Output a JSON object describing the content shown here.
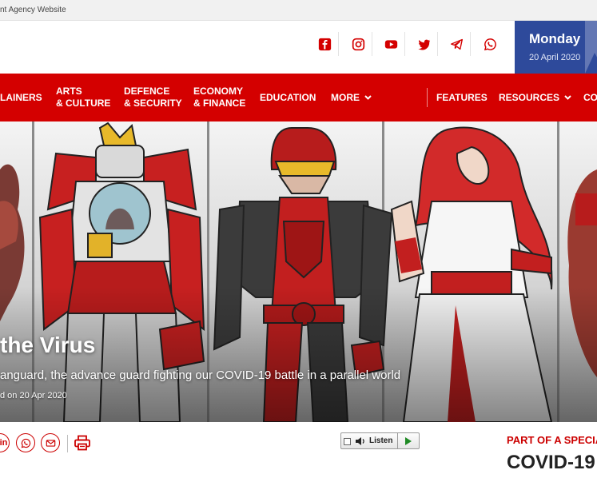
{
  "top_strip": {
    "text": "nt Agency Website"
  },
  "social": {
    "icons": [
      "facebook-icon",
      "instagram-icon",
      "youtube-icon",
      "twitter-icon",
      "telegram-icon",
      "whatsapp-icon"
    ],
    "color": "#d40000"
  },
  "date_box": {
    "day": "Monday",
    "date": "20 April 2020",
    "color": "#2e4a9b"
  },
  "nav": {
    "color": "#d40000",
    "items": [
      {
        "line1": "LAINERS"
      },
      {
        "line1": "ARTS",
        "line2": "& CULTURE"
      },
      {
        "line1": "DEFENCE",
        "line2": "& SECURITY"
      },
      {
        "line1": "ECONOMY",
        "line2": "& FINANCE"
      },
      {
        "line1": "EDUCATION"
      },
      {
        "line1": "MORE",
        "caret": "chevron-down-icon"
      },
      {
        "line1": "FEATURES"
      },
      {
        "line1": "RESOURCES",
        "caret": "chevron-down-icon"
      },
      {
        "line1": "CO"
      }
    ]
  },
  "hero": {
    "title": "the Virus",
    "subtitle": "anguard, the advance guard fighting our COVID-19 battle in a parallel world",
    "meta": "d on 20 Apr 2020"
  },
  "share": {
    "linkedin_text": "in",
    "icons": [
      "linkedin-icon",
      "whatsapp-icon",
      "email-icon",
      "print-icon"
    ]
  },
  "listen": {
    "label": "Listen"
  },
  "special": {
    "label": "PART OF A SPECIA",
    "title": "COVID-19"
  }
}
